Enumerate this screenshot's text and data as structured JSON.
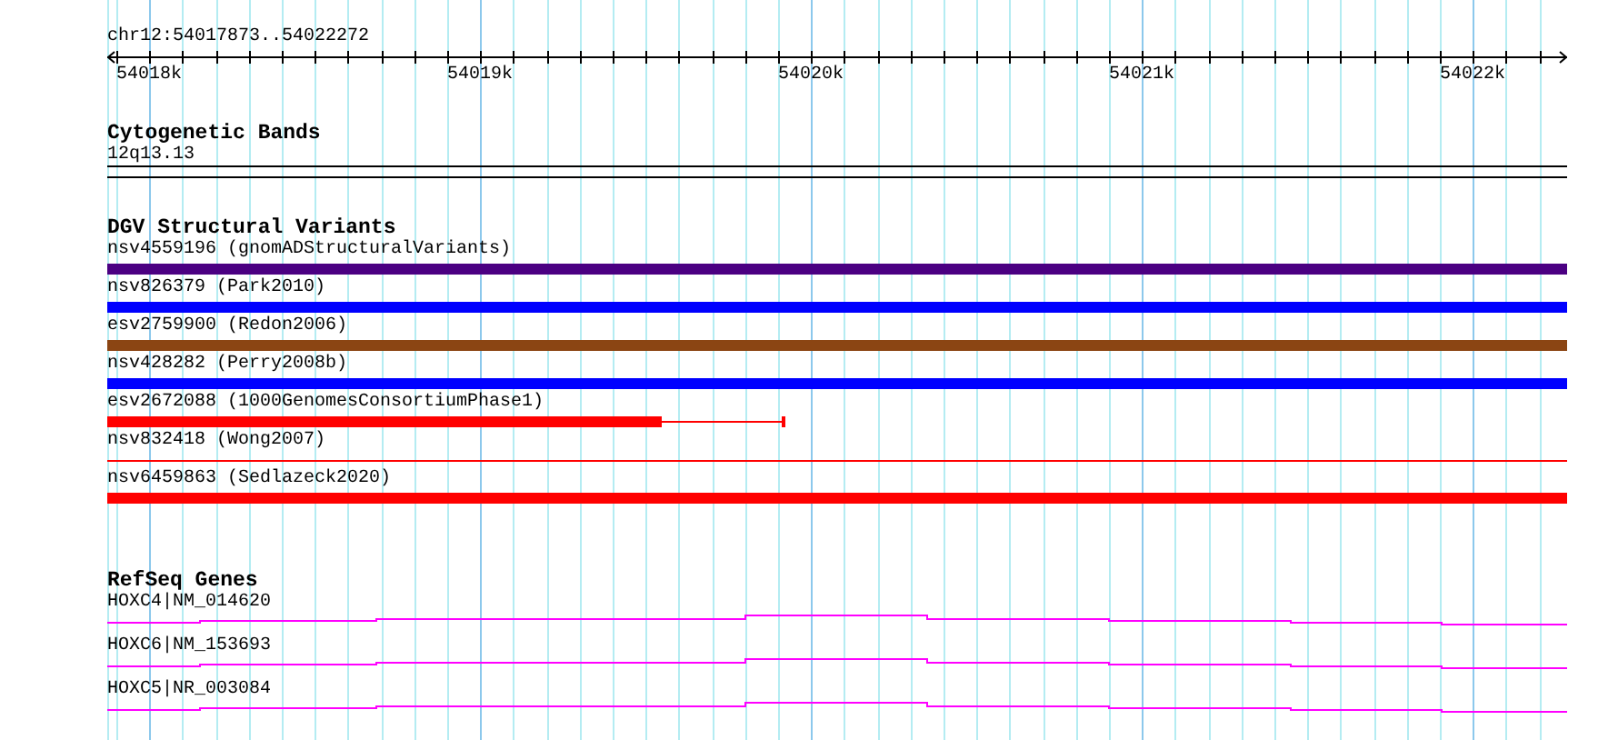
{
  "ruler": {
    "range": "chr12:54017873..54022272",
    "tick_labels": [
      "54018k",
      "54019k",
      "54020k",
      "54021k",
      "54022k"
    ]
  },
  "cytogenetic_bands": {
    "title": "Cytogenetic Bands",
    "band": "12q13.13"
  },
  "dgv": {
    "title": "DGV Structural Variants",
    "features": [
      {
        "label": "nsv4559196 (gnomADStructuralVariants)",
        "color": "#4b0082",
        "kind": "thick"
      },
      {
        "label": "nsv826379 (Park2010)",
        "color": "#0000ff",
        "kind": "thick"
      },
      {
        "label": "esv2759900 (Redon2006)",
        "color": "#8b4513",
        "kind": "thick"
      },
      {
        "label": "nsv428282 (Perry2008b)",
        "color": "#0000ff",
        "kind": "thick"
      },
      {
        "label": "esv2672088 (1000GenomesConsortiumPhase1)",
        "color": "#ff0000",
        "kind": "partial"
      },
      {
        "label": "nsv832418 (Wong2007)",
        "color": "#ff0000",
        "kind": "thin"
      },
      {
        "label": "nsv6459863 (Sedlazeck2020)",
        "color": "#ff0000",
        "kind": "thick"
      }
    ]
  },
  "refseq": {
    "title": "RefSeq Genes",
    "genes": [
      {
        "label": "HOXC4|NM_014620"
      },
      {
        "label": "HOXC6|NM_153693"
      },
      {
        "label": "HOXC5|NR_003084"
      }
    ]
  }
}
